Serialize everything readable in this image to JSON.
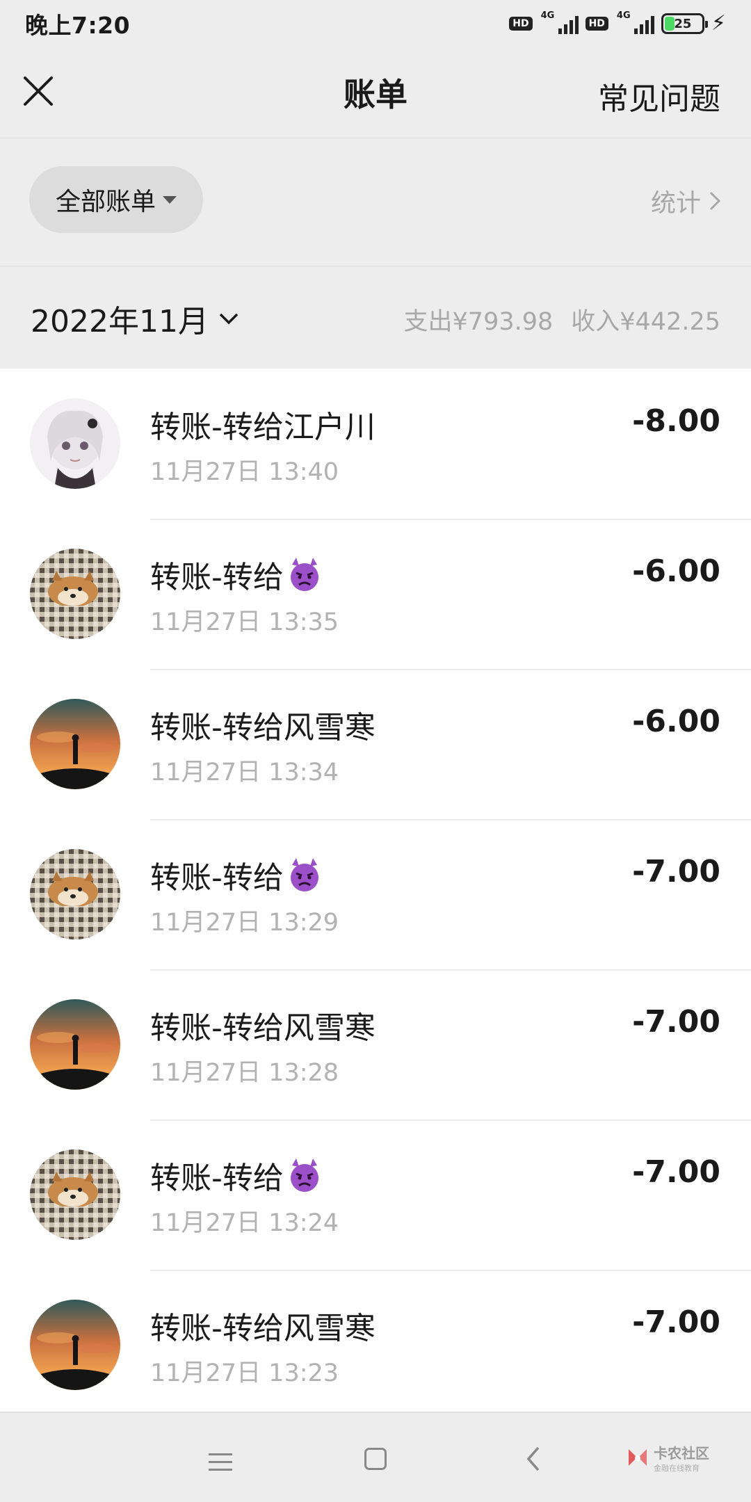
{
  "status_bar": {
    "time": "晚上7:20",
    "network_badge": "HD",
    "network_type": "4G",
    "battery": "25"
  },
  "nav": {
    "title": "账单",
    "faq": "常见问题"
  },
  "filter": {
    "label": "全部账单",
    "stats_label": "统计"
  },
  "month": {
    "label": "2022年11月",
    "expense": "支出¥793.98",
    "income": "收入¥442.25"
  },
  "transactions": [
    {
      "title": "转账-转给江户川",
      "time": "11月27日 13:40",
      "amount": "-8.00",
      "avatar": "anime-girl"
    },
    {
      "title": "转账-转给",
      "emoji": "angry-devil-emoji",
      "time": "11月27日 13:35",
      "amount": "-6.00",
      "avatar": "shiba-dog"
    },
    {
      "title": "转账-转给风雪寒",
      "time": "11月27日 13:34",
      "amount": "-6.00",
      "avatar": "sunset-silhouette"
    },
    {
      "title": "转账-转给",
      "emoji": "angry-devil-emoji",
      "time": "11月27日 13:29",
      "amount": "-7.00",
      "avatar": "shiba-dog"
    },
    {
      "title": "转账-转给风雪寒",
      "time": "11月27日 13:28",
      "amount": "-7.00",
      "avatar": "sunset-silhouette"
    },
    {
      "title": "转账-转给",
      "emoji": "angry-devil-emoji",
      "time": "11月27日 13:24",
      "amount": "-7.00",
      "avatar": "shiba-dog"
    },
    {
      "title": "转账-转给风雪寒",
      "time": "11月27日 13:23",
      "amount": "-7.00",
      "avatar": "sunset-silhouette"
    }
  ],
  "watermark": {
    "name": "卡农社区",
    "sub": "金融在线教育"
  },
  "colors": {
    "background": "#ededed",
    "list_background": "#ffffff",
    "secondary_text": "#a8a8a8",
    "devil_emoji": "#9b4fc8"
  }
}
